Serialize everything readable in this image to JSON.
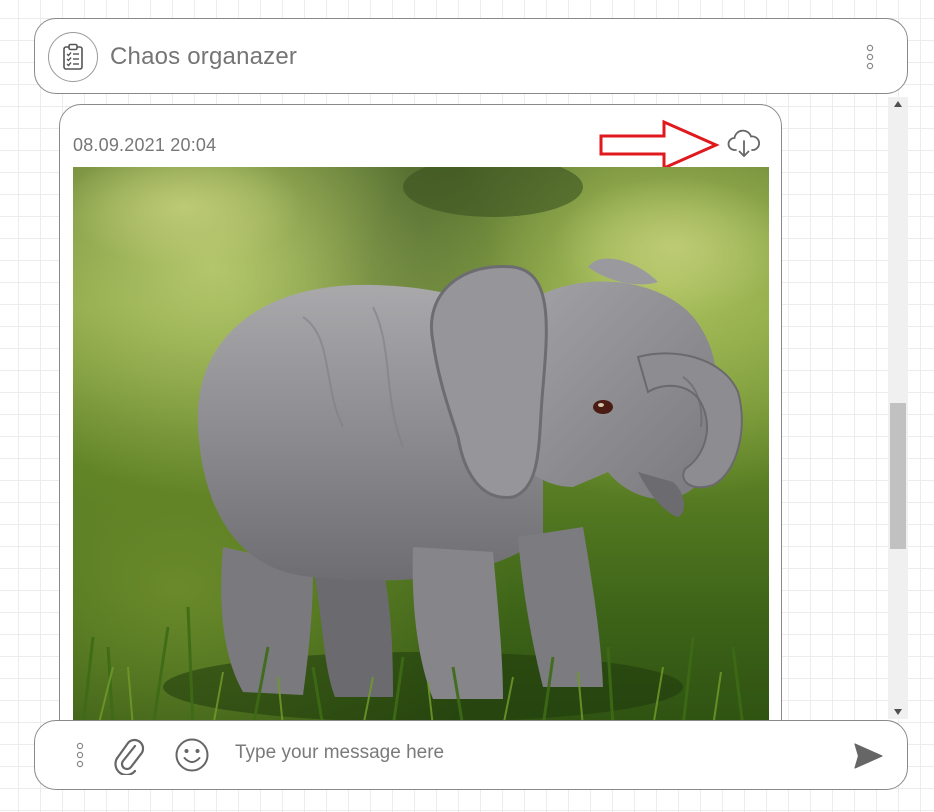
{
  "header": {
    "title": "Chaos organazer",
    "avatar_icon": "clipboard-checklist-icon",
    "menu_icon": "vertical-dots-icon"
  },
  "message": {
    "timestamp": "08.09.2021 20:04",
    "download_icon": "cloud-download-icon",
    "annotation_icon": "red-arrow-icon",
    "annotation_color": "#e0191e",
    "image_subject": "elephant-photo"
  },
  "composer": {
    "menu_icon": "vertical-dots-icon",
    "attach_icon": "paperclip-icon",
    "emoji_icon": "smiley-icon",
    "placeholder": "Type your message here",
    "value": "",
    "send_icon": "send-icon"
  },
  "colors": {
    "border": "#8a8a8a",
    "text_muted": "#757575",
    "grid": "#ececec"
  }
}
